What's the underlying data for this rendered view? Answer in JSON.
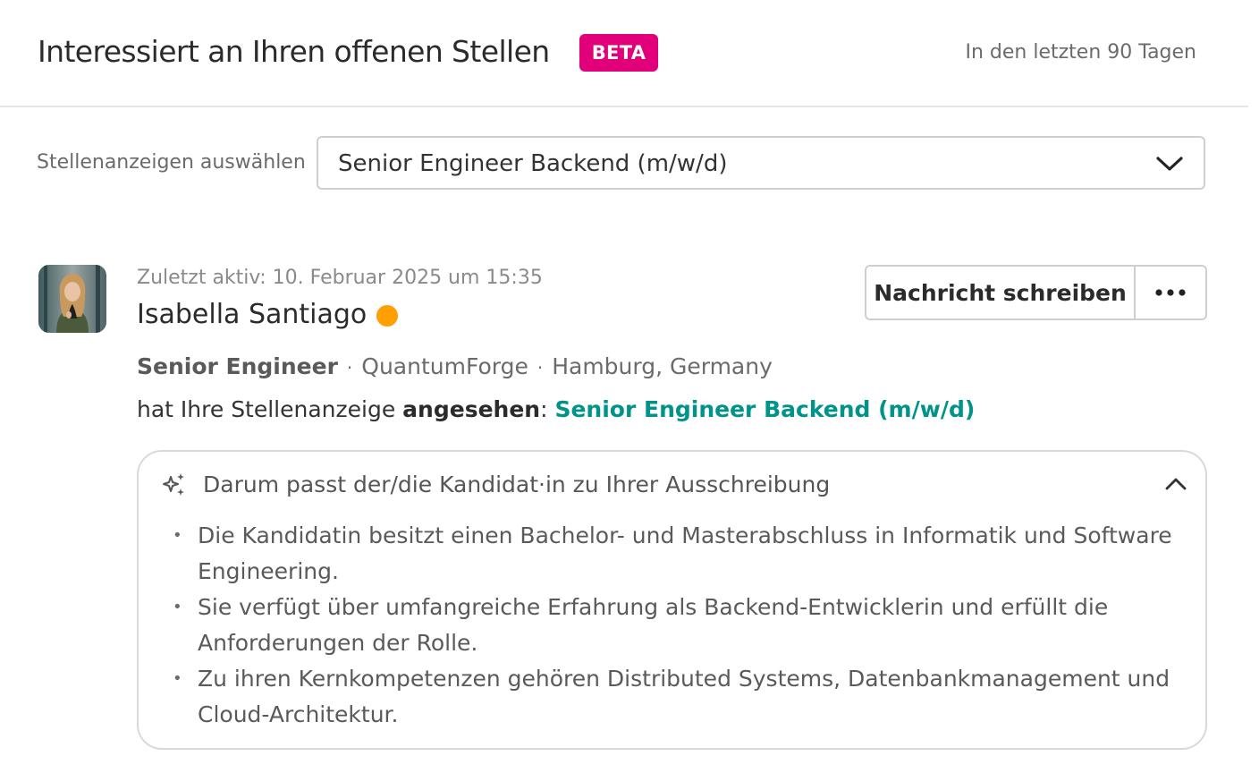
{
  "header": {
    "title": "Interessiert an Ihren offenen Stellen",
    "badge": "BETA",
    "period": "In den letzten 90 Tagen",
    "badge_color": "#e2007a"
  },
  "job_select": {
    "label": "Stellenanzeigen auswählen",
    "selected": "Senior Engineer Backend (m/w/d)",
    "icon": "chevron-down-icon"
  },
  "candidate": {
    "last_active": "Zuletzt aktiv: 10. Februar 2025 um 15:35",
    "name": "Isabella Santiago",
    "status_color": "#ff9f00",
    "role": "Senior Engineer",
    "separator": "·",
    "company": "QuantumForge",
    "location": "Hamburg, Germany",
    "viewed_prefix": "hat Ihre Stellenanzeige ",
    "viewed_action": "angesehen",
    "viewed_colon": ": ",
    "viewed_job": "Senior Engineer Backend (m/w/d)",
    "link_color": "#00938a"
  },
  "actions": {
    "message_label": "Nachricht schreiben",
    "more_icon": "more-horizontal-icon"
  },
  "match": {
    "icon": "sparkle-icon",
    "title": "Darum passt der/die Kandidat·in zu Ihrer Ausschreibung",
    "collapse_icon": "chevron-up-icon",
    "reasons": [
      "Die Kandidatin besitzt einen Bachelor- und Masterabschluss in Informatik und Software Engineering.",
      "Sie verfügt über umfangreiche Erfahrung als Backend-Entwicklerin und erfüllt die Anforderungen der Rolle.",
      "Zu ihren Kernkompetenzen gehören Distributed Systems, Datenbankmanagement und Cloud-Architektur."
    ]
  }
}
